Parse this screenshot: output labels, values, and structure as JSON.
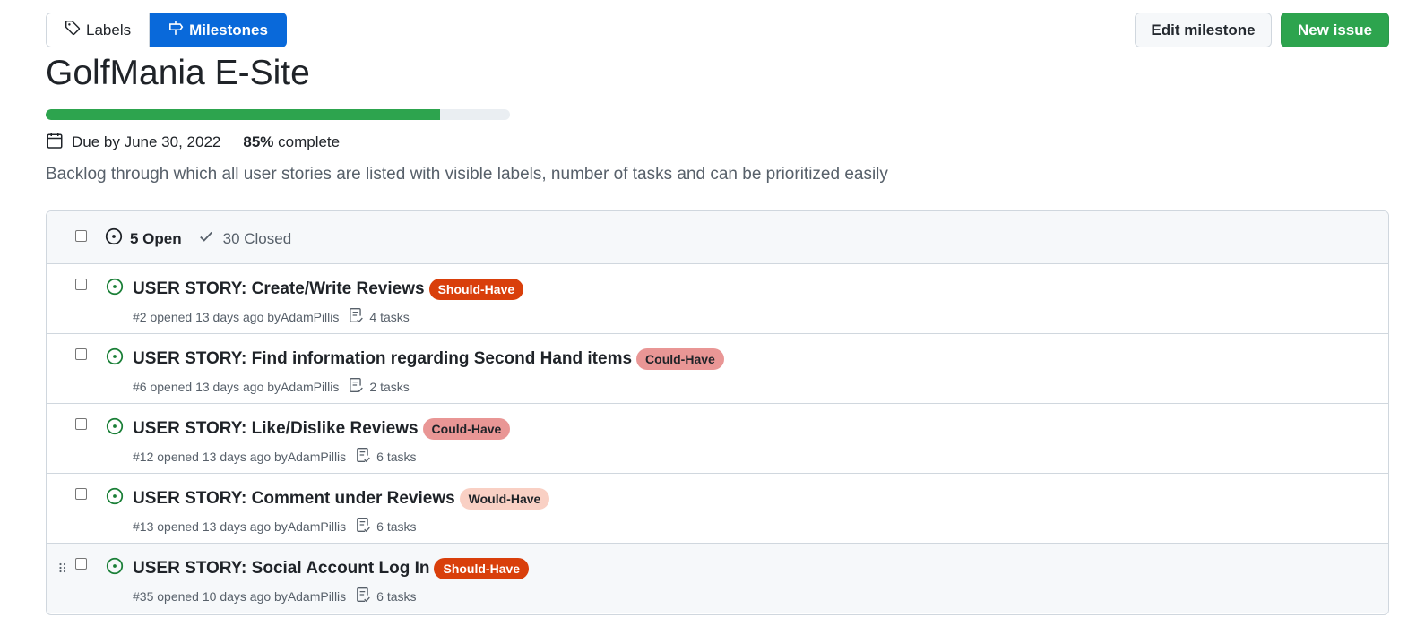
{
  "nav": {
    "labels_tab": "Labels",
    "milestones_tab": "Milestones"
  },
  "actions": {
    "edit_milestone": "Edit milestone",
    "new_issue": "New issue"
  },
  "milestone": {
    "title": "GolfMania E-Site",
    "progress_percent": 85,
    "due": "Due by June 30, 2022",
    "percent_label": "85%",
    "complete_label": "complete",
    "description": "Backlog through which all user stories are listed with visible labels, number of tasks and can be prioritized easily"
  },
  "issues_header": {
    "open": "5 Open",
    "closed": "30 Closed"
  },
  "issues": [
    {
      "title": "USER STORY: Create/Write Reviews",
      "label": "Should-Have",
      "label_bg": "#d93f0b",
      "label_fg": "#ffffff",
      "number_opened": "#2 opened 13 days ago by ",
      "author": "AdamPillis",
      "tasks": "4 tasks"
    },
    {
      "title": "USER STORY: Find information regarding Second Hand items",
      "label": "Could-Have",
      "label_bg": "#e99695",
      "label_fg": "#1f2328",
      "number_opened": "#6 opened 13 days ago by ",
      "author": "AdamPillis",
      "tasks": "2 tasks"
    },
    {
      "title": "USER STORY: Like/Dislike Reviews",
      "label": "Could-Have",
      "label_bg": "#e99695",
      "label_fg": "#1f2328",
      "number_opened": "#12 opened 13 days ago by ",
      "author": "AdamPillis",
      "tasks": "6 tasks"
    },
    {
      "title": "USER STORY: Comment under Reviews",
      "label": "Would-Have",
      "label_bg": "#f9d0c4",
      "label_fg": "#1f2328",
      "number_opened": "#13 opened 13 days ago by ",
      "author": "AdamPillis",
      "tasks": "6 tasks"
    },
    {
      "title": "USER STORY: Social Account Log In",
      "label": "Should-Have",
      "label_bg": "#d93f0b",
      "label_fg": "#ffffff",
      "number_opened": "#35 opened 10 days ago by ",
      "author": "AdamPillis",
      "tasks": "6 tasks"
    }
  ],
  "colors": {
    "accent_blue": "#0969da",
    "success_green": "#2da44e",
    "open_icon_green": "#1a7f37"
  },
  "icons": {
    "labels_tab": "tag-icon",
    "milestones_tab": "milestone-icon",
    "due": "calendar-icon",
    "open": "issue-opened-icon",
    "closed": "check-icon",
    "tasks": "tasklist-icon",
    "drag": "grabber-icon"
  }
}
